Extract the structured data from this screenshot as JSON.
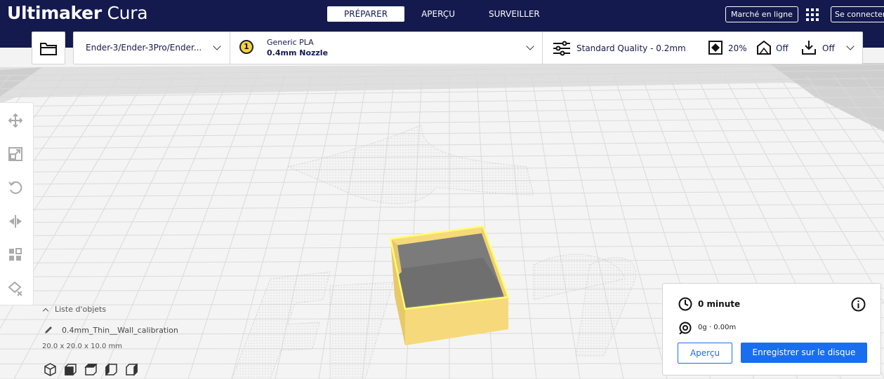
{
  "app": {
    "brand_bold": "Ultimaker",
    "brand_light": "Cura"
  },
  "stages": [
    {
      "label": "PRÉPARER",
      "active": true
    },
    {
      "label": "APERÇU",
      "active": false
    },
    {
      "label": "SURVEILLER",
      "active": false
    }
  ],
  "header": {
    "marketplace_label": "Marché en ligne",
    "signin_label": "Se connecter"
  },
  "printer": {
    "label": "Ender-3/Ender-3Pro/Ender..."
  },
  "extruder": {
    "number": "1",
    "material": "Generic PLA",
    "nozzle": "0.4mm Nozzle",
    "color": "#f5d43c"
  },
  "print_settings": {
    "quality": "Standard Quality - 0.2mm",
    "infill": "20%",
    "support": "Off",
    "adhesion": "Off"
  },
  "object_list": {
    "toggle_label": "Liste d'objets",
    "object_name": "0.4mm_Thin__Wall_calibration",
    "dimensions": "20.0 x 20.0 x 10.0 mm"
  },
  "print_info": {
    "time": "0 minute",
    "material_usage": "0g · 0.00m",
    "preview_label": "Aperçu",
    "save_label": "Enregistrer sur le disque"
  },
  "colors": {
    "header": "#141a4e",
    "accent": "#196ef0",
    "model": "#f8da74",
    "model_outline": "#ffff6b"
  }
}
